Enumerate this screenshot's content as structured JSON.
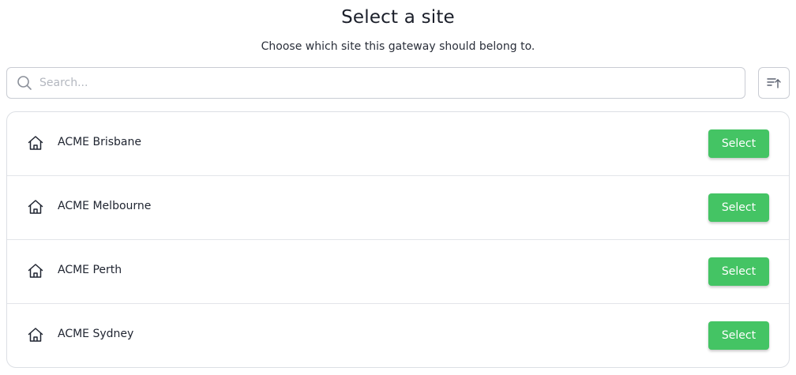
{
  "header": {
    "title": "Select a site",
    "subtitle": "Choose which site this gateway should belong to."
  },
  "search": {
    "placeholder": "Search...",
    "value": "",
    "icon": "search-icon"
  },
  "sort_button": {
    "icon": "sort-ascending-icon"
  },
  "sites": [
    {
      "name": "ACME Brisbane",
      "icon": "home-icon",
      "button_label": "Select"
    },
    {
      "name": "ACME Melbourne",
      "icon": "home-icon",
      "button_label": "Select"
    },
    {
      "name": "ACME Perth",
      "icon": "home-icon",
      "button_label": "Select"
    },
    {
      "name": "ACME Sydney",
      "icon": "home-icon",
      "button_label": "Select"
    }
  ],
  "colors": {
    "accent": "#44c464",
    "border": "#c9ccd3"
  }
}
